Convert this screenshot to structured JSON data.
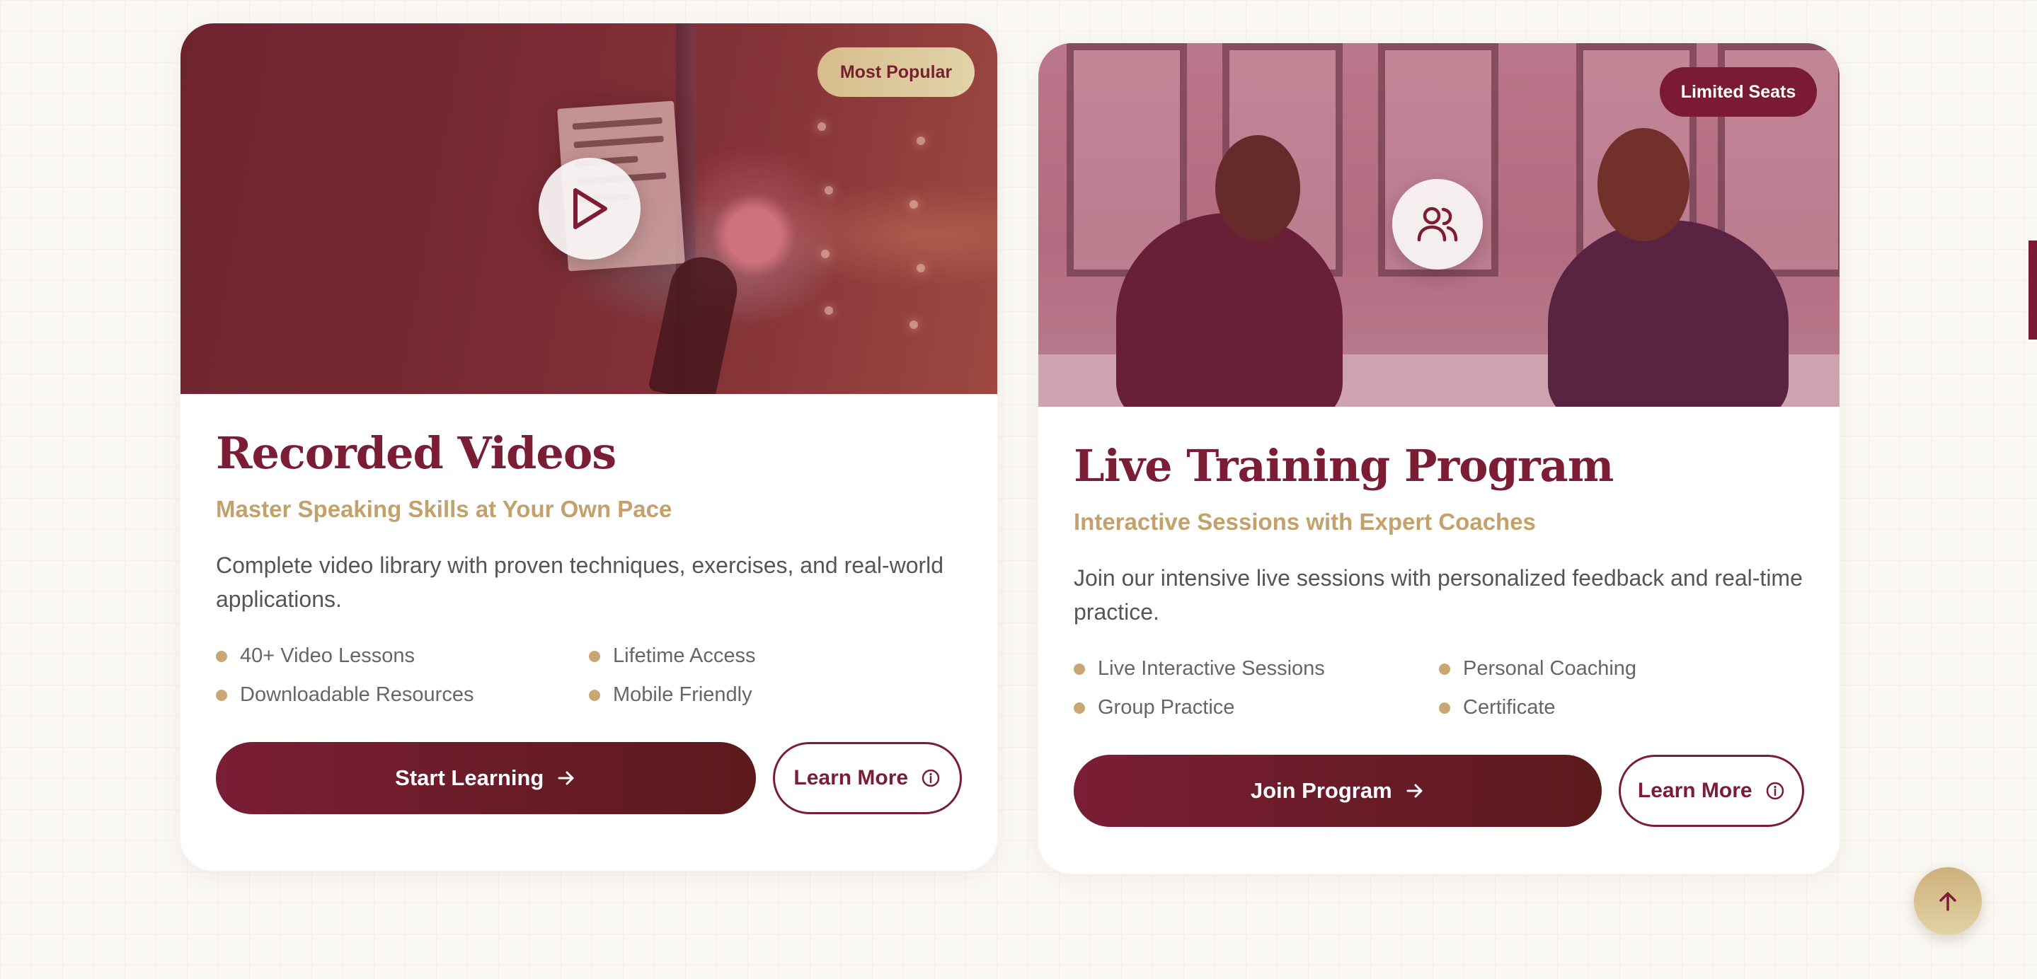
{
  "colors": {
    "primary": "#7b1d34",
    "gold": "#c3a16c",
    "background": "#faf8f4"
  },
  "cards": [
    {
      "badge": "Most Popular",
      "media_icon": "play-icon",
      "title": "Recorded Videos",
      "subtitle": "Master Speaking Skills at Your Own Pace",
      "description": "Complete video library with proven techniques, exercises, and real-world applications.",
      "features": [
        "40+ Video Lessons",
        "Lifetime Access",
        "Downloadable Resources",
        "Mobile Friendly"
      ],
      "primary_button": "Start Learning",
      "secondary_button": "Learn More"
    },
    {
      "badge": "Limited Seats",
      "media_icon": "users-icon",
      "title": "Live Training Program",
      "subtitle": "Interactive Sessions with Expert Coaches",
      "description": "Join our intensive live sessions with personalized feedback and real-time practice.",
      "features": [
        "Live Interactive Sessions",
        "Personal Coaching",
        "Group Practice",
        "Certificate"
      ],
      "primary_button": "Join Program",
      "secondary_button": "Learn More"
    }
  ],
  "scroll_top_icon": "arrow-up-icon"
}
